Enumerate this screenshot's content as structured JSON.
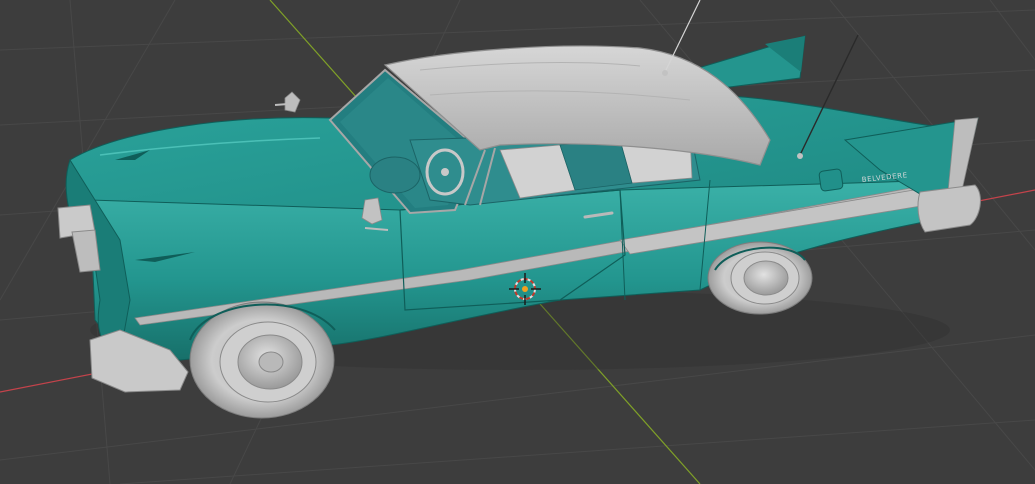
{
  "viewport": {
    "mode": "3d-viewport",
    "shading": "solid",
    "background_color": "#3d3d3d",
    "grid_color": "#484848",
    "axis_x_color": "#c4434b",
    "axis_y_color": "#7fa028"
  },
  "scene": {
    "object": "classic-convertible-car",
    "body_color": "#23968f",
    "body_shadow_color": "#17706a",
    "body_highlight_color": "#3bb1a8",
    "trim_color": "#b9b9b9",
    "soft_top_color": "#c2c2c2",
    "interior_color": "#2f8d8e",
    "tire_color": "#c4c4c4"
  },
  "overlays": {
    "cursor_icon": "3d-cursor-icon",
    "fender_badge": "BELVEDERE"
  }
}
